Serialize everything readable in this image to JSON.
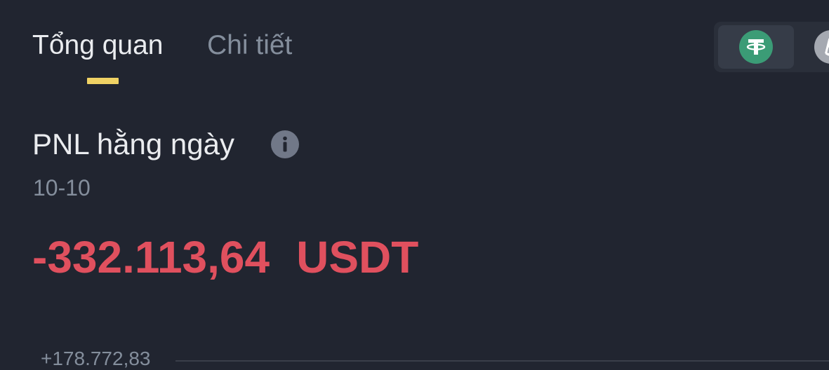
{
  "tabs": [
    {
      "label": "Tổng quan",
      "active": true
    },
    {
      "label": "Chi tiết",
      "active": false
    }
  ],
  "asset_switcher": {
    "options": [
      {
        "icon": "usdt-icon",
        "selected": true
      },
      {
        "icon": "btc-icon",
        "selected": false
      }
    ]
  },
  "pnl": {
    "title": "PNL hằng ngày",
    "date": "10-10",
    "amount": "-332.113,64",
    "unit": "USDT"
  },
  "chart": {
    "y_label_top": "+178.772,83"
  },
  "colors": {
    "background": "#212530",
    "accent": "#f0d264",
    "negative": "#e0505e",
    "muted_text": "#848e9c",
    "usdt_green": "#3b9c76"
  }
}
